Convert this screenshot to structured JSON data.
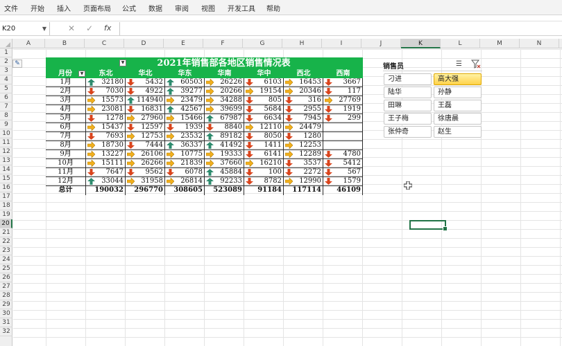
{
  "ribbon": {
    "tabs": [
      "文件",
      "开始",
      "插入",
      "页面布局",
      "公式",
      "数据",
      "审阅",
      "视图",
      "开发工具",
      "帮助"
    ]
  },
  "formula_bar": {
    "name_box": "K20",
    "cancel_glyph": "✕",
    "enter_glyph": "✓",
    "fx_label": "fx",
    "formula_value": ""
  },
  "grid": {
    "columns": [
      "A",
      "B",
      "C",
      "D",
      "E",
      "F",
      "G",
      "H",
      "I",
      "J",
      "K",
      "L",
      "M",
      "N"
    ],
    "rows": [
      "1",
      "2",
      "3",
      "4",
      "5",
      "6",
      "7",
      "8",
      "9",
      "10",
      "11",
      "12",
      "13",
      "14",
      "15",
      "16",
      "17",
      "18",
      "19",
      "20",
      "21",
      "22",
      "23",
      "24",
      "25",
      "26",
      "27",
      "28",
      "29",
      "30",
      "31",
      "32"
    ],
    "selected_column": "K",
    "selected_row": "20"
  },
  "sales_table": {
    "title": "2021年销售部各地区销售情况表",
    "header_month": "月份",
    "regions": [
      "东北",
      "华北",
      "华东",
      "华南",
      "华中",
      "西北",
      "西南"
    ],
    "rows": [
      {
        "month": "1月",
        "cells": [
          {
            "v": "32180",
            "t": "up"
          },
          {
            "v": "5432",
            "t": "down"
          },
          {
            "v": "60503",
            "t": "up"
          },
          {
            "v": "26226",
            "t": "flat"
          },
          {
            "v": "6103",
            "t": "down"
          },
          {
            "v": "16453",
            "t": "flat"
          },
          {
            "v": "3667",
            "t": "down"
          }
        ]
      },
      {
        "month": "2月",
        "cells": [
          {
            "v": "7030",
            "t": "down"
          },
          {
            "v": "4922",
            "t": "down"
          },
          {
            "v": "39277",
            "t": "up"
          },
          {
            "v": "20266",
            "t": "flat"
          },
          {
            "v": "19154",
            "t": "flat"
          },
          {
            "v": "20346",
            "t": "flat"
          },
          {
            "v": "117",
            "t": "down"
          }
        ]
      },
      {
        "month": "3月",
        "cells": [
          {
            "v": "15573",
            "t": "flat"
          },
          {
            "v": "114940",
            "t": "up"
          },
          {
            "v": "23479",
            "t": "flat"
          },
          {
            "v": "34288",
            "t": "flat"
          },
          {
            "v": "805",
            "t": "down"
          },
          {
            "v": "316",
            "t": "down"
          },
          {
            "v": "27769",
            "t": "flat"
          }
        ]
      },
      {
        "month": "4月",
        "cells": [
          {
            "v": "23081",
            "t": "flat"
          },
          {
            "v": "16831",
            "t": "down"
          },
          {
            "v": "42567",
            "t": "up"
          },
          {
            "v": "39699",
            "t": "flat"
          },
          {
            "v": "5684",
            "t": "down"
          },
          {
            "v": "2955",
            "t": "down"
          },
          {
            "v": "1919",
            "t": "down"
          }
        ]
      },
      {
        "month": "5月",
        "cells": [
          {
            "v": "1278",
            "t": "down"
          },
          {
            "v": "27960",
            "t": "flat"
          },
          {
            "v": "15466",
            "t": "flat"
          },
          {
            "v": "67987",
            "t": "up"
          },
          {
            "v": "6634",
            "t": "down"
          },
          {
            "v": "7945",
            "t": "down"
          },
          {
            "v": "299",
            "t": "down"
          }
        ]
      },
      {
        "month": "6月",
        "cells": [
          {
            "v": "15437",
            "t": "flat"
          },
          {
            "v": "12597",
            "t": "down"
          },
          {
            "v": "1939",
            "t": "down"
          },
          {
            "v": "8840",
            "t": "down"
          },
          {
            "v": "12110",
            "t": "flat"
          },
          {
            "v": "24479",
            "t": "flat"
          },
          {
            "v": "",
            "t": ""
          }
        ]
      },
      {
        "month": "7月",
        "cells": [
          {
            "v": "7693",
            "t": "down"
          },
          {
            "v": "12753",
            "t": "flat"
          },
          {
            "v": "23532",
            "t": "flat"
          },
          {
            "v": "89182",
            "t": "up"
          },
          {
            "v": "8050",
            "t": "down"
          },
          {
            "v": "1280",
            "t": "down"
          },
          {
            "v": "",
            "t": ""
          }
        ]
      },
      {
        "month": "8月",
        "cells": [
          {
            "v": "18730",
            "t": "flat"
          },
          {
            "v": "7444",
            "t": "down"
          },
          {
            "v": "36337",
            "t": "up"
          },
          {
            "v": "41492",
            "t": "up"
          },
          {
            "v": "1411",
            "t": "down"
          },
          {
            "v": "12253",
            "t": "flat"
          },
          {
            "v": "",
            "t": ""
          }
        ]
      },
      {
        "month": "9月",
        "cells": [
          {
            "v": "13227",
            "t": "flat"
          },
          {
            "v": "26106",
            "t": "flat"
          },
          {
            "v": "10775",
            "t": "flat"
          },
          {
            "v": "19333",
            "t": "flat"
          },
          {
            "v": "6141",
            "t": "down"
          },
          {
            "v": "12289",
            "t": "flat"
          },
          {
            "v": "4780",
            "t": "down"
          }
        ]
      },
      {
        "month": "10月",
        "cells": [
          {
            "v": "15111",
            "t": "flat"
          },
          {
            "v": "26266",
            "t": "flat"
          },
          {
            "v": "21839",
            "t": "flat"
          },
          {
            "v": "37660",
            "t": "flat"
          },
          {
            "v": "16210",
            "t": "flat"
          },
          {
            "v": "3537",
            "t": "down"
          },
          {
            "v": "5412",
            "t": "down"
          }
        ]
      },
      {
        "month": "11月",
        "cells": [
          {
            "v": "7647",
            "t": "down"
          },
          {
            "v": "9562",
            "t": "down"
          },
          {
            "v": "6078",
            "t": "down"
          },
          {
            "v": "45884",
            "t": "up"
          },
          {
            "v": "100",
            "t": "down"
          },
          {
            "v": "2272",
            "t": "down"
          },
          {
            "v": "567",
            "t": "down"
          }
        ]
      },
      {
        "month": "12月",
        "cells": [
          {
            "v": "33044",
            "t": "up"
          },
          {
            "v": "31958",
            "t": "flat"
          },
          {
            "v": "26814",
            "t": "flat"
          },
          {
            "v": "92233",
            "t": "up"
          },
          {
            "v": "8782",
            "t": "down"
          },
          {
            "v": "12990",
            "t": "flat"
          },
          {
            "v": "1579",
            "t": "down"
          }
        ]
      }
    ],
    "total_label": "总计",
    "totals": [
      "190032",
      "296770",
      "308605",
      "523089",
      "91184",
      "117114",
      "46109"
    ]
  },
  "slicer": {
    "title": "销售员",
    "items": [
      {
        "label": "刁进",
        "selected": false
      },
      {
        "label": "高大强",
        "selected": true
      },
      {
        "label": "陆华",
        "selected": false
      },
      {
        "label": "孙静",
        "selected": false
      },
      {
        "label": "田琳",
        "selected": false
      },
      {
        "label": "王磊",
        "selected": false
      },
      {
        "label": "王子梅",
        "selected": false
      },
      {
        "label": "徐唐晨",
        "selected": false
      },
      {
        "label": "张仲奇",
        "selected": false
      },
      {
        "label": "赵生",
        "selected": false
      }
    ]
  },
  "colors": {
    "table_header": "#17b34a",
    "arrow_up": "#2e8b6e",
    "arrow_down": "#d9441c",
    "arrow_flat": "#f2b01e",
    "selection": "#217346"
  }
}
